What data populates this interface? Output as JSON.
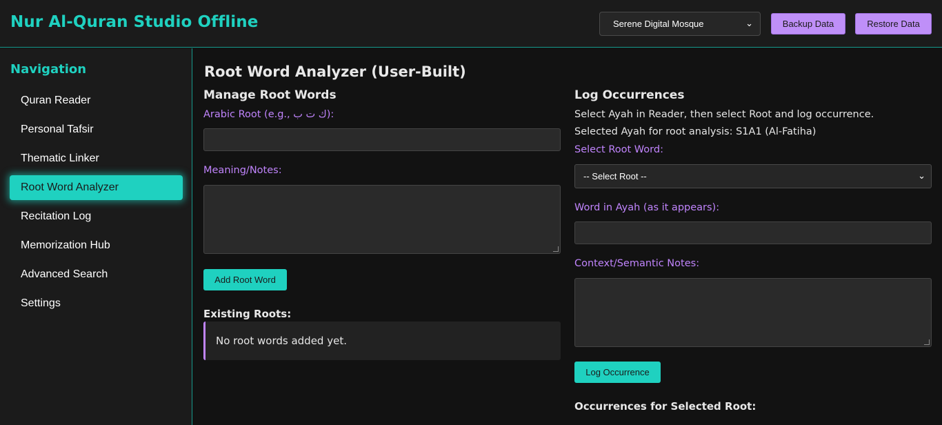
{
  "header": {
    "app_title": "Nur Al-Quran Studio Offline",
    "theme_selected": "Serene Digital Mosque",
    "backup_label": "Backup Data",
    "restore_label": "Restore Data"
  },
  "sidebar": {
    "title": "Navigation",
    "items": [
      {
        "label": "Quran Reader"
      },
      {
        "label": "Personal Tafsir"
      },
      {
        "label": "Thematic Linker"
      },
      {
        "label": "Root Word Analyzer"
      },
      {
        "label": "Recitation Log"
      },
      {
        "label": "Memorization Hub"
      },
      {
        "label": "Advanced Search"
      },
      {
        "label": "Settings"
      }
    ],
    "active_item": "Root Word Analyzer"
  },
  "main": {
    "page_title": "Root Word Analyzer (User-Built)",
    "manage": {
      "title": "Manage Root Words",
      "arabic_root_label": "Arabic Root (e.g., ك ت ب):",
      "arabic_root_value": "",
      "meaning_label": "Meaning/Notes:",
      "meaning_value": "",
      "add_button": "Add Root Word",
      "existing_title": "Existing Roots:",
      "empty_message": "No root words added yet."
    },
    "log": {
      "title": "Log Occurrences",
      "instruction": "Select Ayah in Reader, then select Root and log occurrence.",
      "selected_ayah": "Selected Ayah for root analysis: S1A1 (Al-Fatiha)",
      "select_root_label": "Select Root Word:",
      "select_root_value": "-- Select Root --",
      "word_label": "Word in Ayah (as it appears):",
      "word_value": "",
      "context_label": "Context/Semantic Notes:",
      "context_value": "",
      "log_button": "Log Occurrence",
      "occurrences_title": "Occurrences for Selected Root:"
    }
  },
  "colors": {
    "accent_teal": "#1fd1c0",
    "accent_purple": "#c084fc",
    "background": "#121212"
  }
}
